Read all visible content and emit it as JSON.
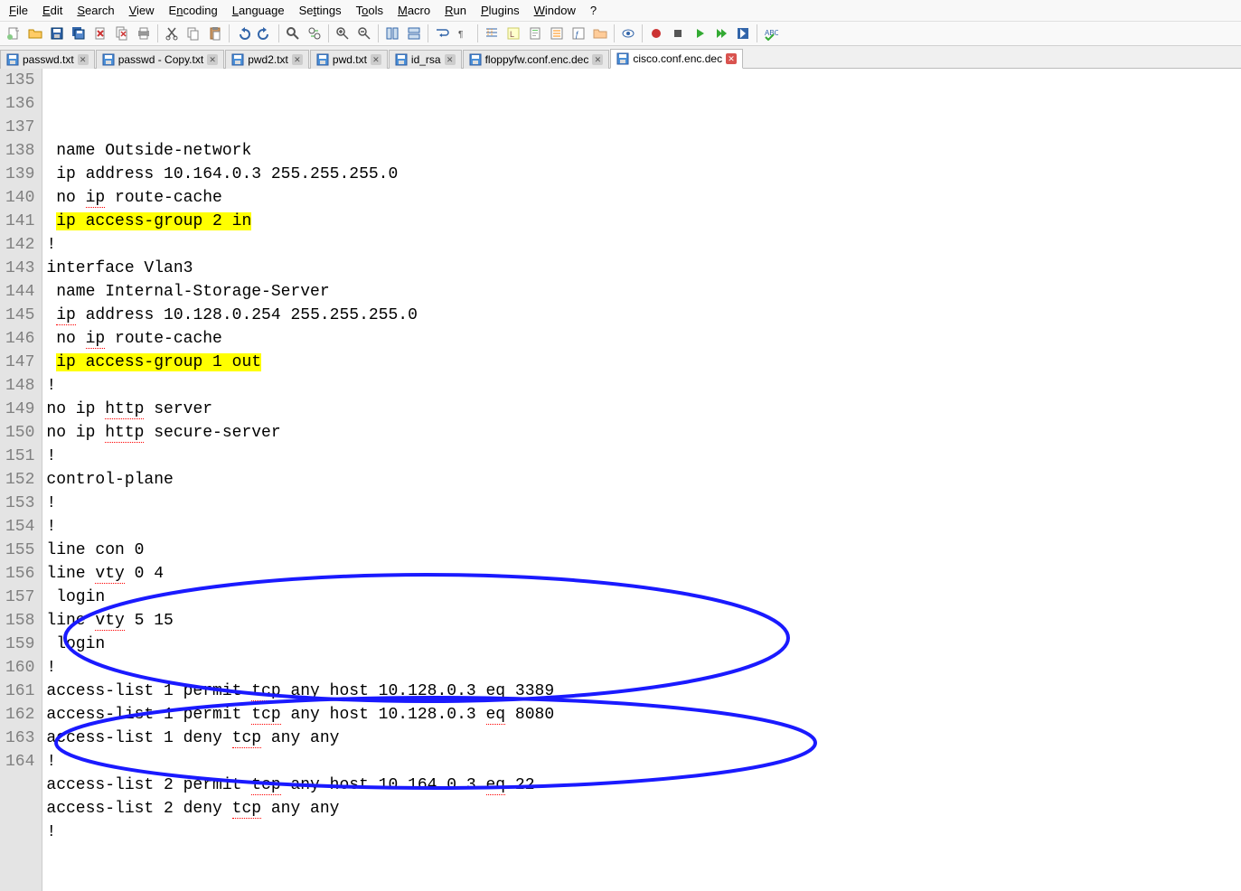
{
  "menubar": [
    {
      "label": "File",
      "ul": "F"
    },
    {
      "label": "Edit",
      "ul": "E"
    },
    {
      "label": "Search",
      "ul": "S"
    },
    {
      "label": "View",
      "ul": "V"
    },
    {
      "label": "Encoding",
      "ul": "n"
    },
    {
      "label": "Language",
      "ul": "L"
    },
    {
      "label": "Settings",
      "ul": "t"
    },
    {
      "label": "Tools",
      "ul": "o"
    },
    {
      "label": "Macro",
      "ul": "M"
    },
    {
      "label": "Run",
      "ul": "R"
    },
    {
      "label": "Plugins",
      "ul": "P"
    },
    {
      "label": "Window",
      "ul": "W"
    },
    {
      "label": "?",
      "ul": "?"
    }
  ],
  "toolbar_groups": [
    [
      "new-icon",
      "open-icon",
      "save-icon",
      "save-all-icon",
      "close-icon",
      "close-all-icon",
      "print-icon"
    ],
    [
      "cut-icon",
      "copy-icon",
      "paste-icon"
    ],
    [
      "undo-icon",
      "redo-icon"
    ],
    [
      "find-icon",
      "replace-icon"
    ],
    [
      "zoom-in-icon",
      "zoom-out-icon"
    ],
    [
      "sync-v-icon",
      "sync-h-icon"
    ],
    [
      "wrap-icon",
      "show-all-icon"
    ],
    [
      "indent-guide-icon",
      "userdef-icon",
      "doc-map-icon",
      "doc-list-icon",
      "func-list-icon",
      "folder-icon"
    ],
    [
      "monitor-icon"
    ],
    [
      "record-icon",
      "stop-icon",
      "play-icon",
      "play-multi-icon",
      "save-macro-icon"
    ],
    [
      "spellcheck-icon"
    ]
  ],
  "tabs": [
    {
      "label": "passwd.txt",
      "active": false,
      "dirty": false
    },
    {
      "label": "passwd - Copy.txt",
      "active": false,
      "dirty": false
    },
    {
      "label": "pwd2.txt",
      "active": false,
      "dirty": false
    },
    {
      "label": "pwd.txt",
      "active": false,
      "dirty": false
    },
    {
      "label": "id_rsa",
      "active": false,
      "dirty": false
    },
    {
      "label": "floppyfw.conf.enc.dec",
      "active": false,
      "dirty": false
    },
    {
      "label": "cisco.conf.enc.dec",
      "active": true,
      "dirty": true
    }
  ],
  "first_line": 135,
  "lines": [
    {
      "n": 135,
      "t": " name Outside-network"
    },
    {
      "n": 136,
      "t": " ip address 10.164.0.3 255.255.255.0"
    },
    {
      "n": 137,
      "t": " no ",
      "sp": "ip",
      "t2": " route-cache"
    },
    {
      "n": 138,
      "t": " ",
      "hl": "ip access-group 2 in"
    },
    {
      "n": 139,
      "t": "!"
    },
    {
      "n": 140,
      "t": "interface Vlan3"
    },
    {
      "n": 141,
      "t": " name Internal-Storage-Server"
    },
    {
      "n": 142,
      "t": " ",
      "sp": "ip",
      "t2": " address 10.128.0.254 255.255.255.0"
    },
    {
      "n": 143,
      "t": " no ",
      "sp": "ip",
      "t2": " route-cache"
    },
    {
      "n": 144,
      "t": " ",
      "hl": "ip access-group 1 out"
    },
    {
      "n": 145,
      "t": "!"
    },
    {
      "n": 146,
      "t": "no ip ",
      "sp": "http",
      "t2": " server"
    },
    {
      "n": 147,
      "t": "no ip ",
      "sp": "http",
      "t2": " secure-server"
    },
    {
      "n": 148,
      "t": "!"
    },
    {
      "n": 149,
      "t": "control-plane"
    },
    {
      "n": 150,
      "t": "!"
    },
    {
      "n": 151,
      "t": "!"
    },
    {
      "n": 152,
      "t": "line con 0"
    },
    {
      "n": 153,
      "t": "line ",
      "sp": "vty",
      "t2": " 0 4"
    },
    {
      "n": 154,
      "t": " login"
    },
    {
      "n": 155,
      "t": "line ",
      "sp": "vty",
      "t2": " 5 15"
    },
    {
      "n": 156,
      "t": " login"
    },
    {
      "n": 157,
      "t": "!"
    },
    {
      "n": 158,
      "t": "access-list 1 permit ",
      "sp": "tcp",
      "t2": " any host 10.128.0.3 ",
      "sp2": "eq",
      "t3": " 3389"
    },
    {
      "n": 159,
      "t": "access-list 1 permit ",
      "sp": "tcp",
      "t2": " any host 10.128.0.3 ",
      "sp2": "eq",
      "t3": " 8080"
    },
    {
      "n": 160,
      "t": "access-list 1 deny ",
      "sp": "tcp",
      "t2": " any any"
    },
    {
      "n": 161,
      "t": "!"
    },
    {
      "n": 162,
      "t": "access-list 2 permit ",
      "sp": "tcp",
      "t2": " any host 10.164.0.3 ",
      "sp2": "eq",
      "t3": " 22"
    },
    {
      "n": 163,
      "t": "access-list 2 deny ",
      "sp": "tcp",
      "t2": " any any"
    },
    {
      "n": 164,
      "t": "!"
    }
  ]
}
